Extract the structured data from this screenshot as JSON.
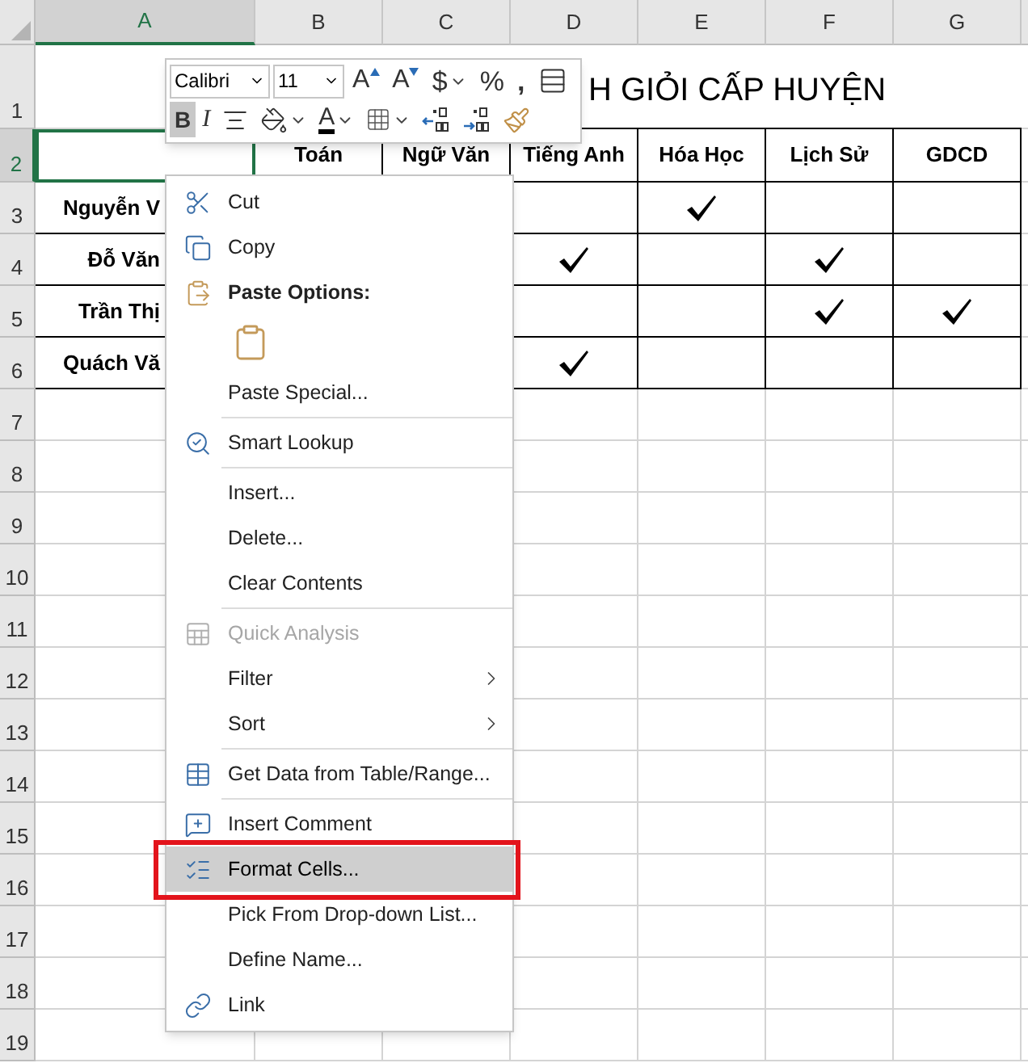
{
  "sheet": {
    "columns": [
      {
        "label": "A",
        "selected": true
      },
      {
        "label": "B",
        "selected": false
      },
      {
        "label": "C",
        "selected": false
      },
      {
        "label": "D",
        "selected": false
      },
      {
        "label": "E",
        "selected": false
      },
      {
        "label": "F",
        "selected": false
      },
      {
        "label": "G",
        "selected": false
      }
    ],
    "row_headers": [
      {
        "label": "1",
        "selected": false
      },
      {
        "label": "2",
        "selected": true
      },
      {
        "label": "3",
        "selected": false
      },
      {
        "label": "4",
        "selected": false
      },
      {
        "label": "5",
        "selected": false
      },
      {
        "label": "6",
        "selected": false
      },
      {
        "label": "7",
        "selected": false
      },
      {
        "label": "8",
        "selected": false
      },
      {
        "label": "9",
        "selected": false
      },
      {
        "label": "10",
        "selected": false
      },
      {
        "label": "11",
        "selected": false
      },
      {
        "label": "12",
        "selected": false
      },
      {
        "label": "13",
        "selected": false
      },
      {
        "label": "14",
        "selected": false
      },
      {
        "label": "15",
        "selected": false
      },
      {
        "label": "16",
        "selected": false
      },
      {
        "label": "17",
        "selected": false
      },
      {
        "label": "18",
        "selected": false
      },
      {
        "label": "19",
        "selected": false
      }
    ],
    "title": "H GIỎI CẤP HUYỆN",
    "subject_headers": [
      "Toán",
      "Ngữ Văn",
      "Tiếng Anh",
      "Hóa Học",
      "Lịch Sử",
      "GDCD"
    ],
    "students": [
      {
        "name": "Nguyễn V",
        "checks": [
          {
            "checked": false
          },
          {
            "checked": true
          },
          {
            "checked": false
          },
          {
            "checked": false
          }
        ]
      },
      {
        "name": "Đỗ Văn",
        "checks": [
          {
            "checked": true
          },
          {
            "checked": false
          },
          {
            "checked": true
          },
          {
            "checked": false
          }
        ]
      },
      {
        "name": "Trần Thị",
        "checks": [
          {
            "checked": false
          },
          {
            "checked": false
          },
          {
            "checked": true
          },
          {
            "checked": true
          }
        ]
      },
      {
        "name": "Quách Vă",
        "checks": [
          {
            "checked": true
          },
          {
            "checked": false
          },
          {
            "checked": false
          },
          {
            "checked": false
          }
        ]
      }
    ]
  },
  "mini_toolbar": {
    "font": "Calibri",
    "size": "11",
    "row_1": [
      {
        "kind": "grow-font",
        "label": "A",
        "dropdown": false,
        "pressed": false
      },
      {
        "kind": "shrink-font",
        "label": "A",
        "dropdown": false,
        "pressed": false
      },
      {
        "kind": "currency",
        "label": "$",
        "dropdown": true,
        "pressed": false
      },
      {
        "kind": "percent",
        "label": "%",
        "dropdown": false,
        "pressed": false
      },
      {
        "kind": "comma",
        "label": ",",
        "dropdown": false,
        "pressed": false
      },
      {
        "kind": "merge",
        "dropdown": false,
        "pressed": false
      }
    ],
    "row_2": [
      {
        "kind": "bold",
        "label": "B",
        "dropdown": false,
        "pressed": true
      },
      {
        "kind": "italic",
        "label": "I",
        "dropdown": false,
        "pressed": false
      },
      {
        "kind": "align-center",
        "dropdown": false,
        "pressed": false
      },
      {
        "kind": "fill-color",
        "dropdown": true,
        "pressed": false
      },
      {
        "kind": "font-color",
        "label": "A",
        "dropdown": true,
        "pressed": false
      },
      {
        "kind": "borders",
        "dropdown": true,
        "pressed": false
      },
      {
        "kind": "increase-decimal",
        "dropdown": false,
        "pressed": false
      },
      {
        "kind": "decrease-decimal",
        "dropdown": false,
        "pressed": false
      },
      {
        "kind": "format-painter",
        "dropdown": false,
        "pressed": false
      }
    ]
  },
  "context_menu": {
    "sections": [
      [
        {
          "kind": "command",
          "label": "Cut",
          "disabled": false,
          "submenu": false,
          "selected": false
        },
        {
          "kind": "command",
          "label": "Copy",
          "disabled": false,
          "submenu": false,
          "selected": false
        },
        {
          "kind": "heading",
          "label": "Paste Options:",
          "disabled": false,
          "submenu": false,
          "selected": false
        },
        {
          "kind": "paste-option",
          "disabled": false,
          "submenu": false,
          "selected": false
        },
        {
          "kind": "command",
          "label": "Paste Special...",
          "disabled": false,
          "submenu": false,
          "selected": false
        }
      ],
      [
        {
          "kind": "command",
          "label": "Smart Lookup",
          "disabled": false,
          "submenu": false,
          "selected": false
        }
      ],
      [
        {
          "kind": "command",
          "label": "Insert...",
          "disabled": false,
          "submenu": false,
          "selected": false
        },
        {
          "kind": "command",
          "label": "Delete...",
          "disabled": false,
          "submenu": false,
          "selected": false
        },
        {
          "kind": "command",
          "label": "Clear Contents",
          "disabled": false,
          "submenu": false,
          "selected": false
        }
      ],
      [
        {
          "kind": "command",
          "label": "Quick Analysis",
          "disabled": true,
          "submenu": false,
          "selected": false
        },
        {
          "kind": "command",
          "label": "Filter",
          "disabled": false,
          "submenu": true,
          "selected": false
        },
        {
          "kind": "command",
          "label": "Sort",
          "disabled": false,
          "submenu": true,
          "selected": false
        }
      ],
      [
        {
          "kind": "command",
          "label": "Get Data from Table/Range...",
          "disabled": false,
          "submenu": false,
          "selected": false
        }
      ],
      [
        {
          "kind": "command",
          "label": "Insert Comment",
          "disabled": false,
          "submenu": false,
          "selected": false
        },
        {
          "kind": "command",
          "label": "Format Cells...",
          "disabled": false,
          "submenu": false,
          "selected": true
        },
        {
          "kind": "command",
          "label": "Pick From Drop-down List...",
          "disabled": false,
          "submenu": false,
          "selected": false
        },
        {
          "kind": "command",
          "label": "Define Name...",
          "disabled": false,
          "submenu": false,
          "selected": false
        },
        {
          "kind": "command",
          "label": "Link",
          "disabled": false,
          "submenu": false,
          "selected": false
        }
      ]
    ]
  }
}
